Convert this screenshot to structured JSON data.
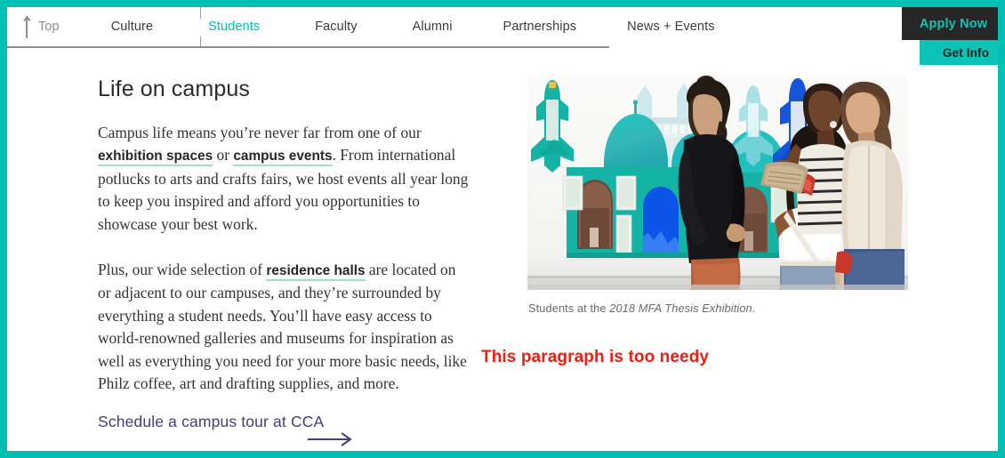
{
  "theme": {
    "teal": "#00bfb3",
    "teal_button": "#0cc3b6",
    "dark": "#262626",
    "link_purple": "#463b7b",
    "link_underline": "#9fd9d2",
    "annotation_red": "#ee1d11",
    "body_text": "#333333"
  },
  "nav": {
    "top": {
      "label": "Top",
      "icon": "arrow-up-icon"
    },
    "items": [
      {
        "label": "Culture",
        "active": false
      },
      {
        "label": "Students",
        "active": true
      },
      {
        "label": "Faculty",
        "active": false
      },
      {
        "label": "Alumni",
        "active": false
      },
      {
        "label": "Partnerships",
        "active": false
      },
      {
        "label": "News + Events",
        "active": false
      }
    ]
  },
  "cta": {
    "apply_label": "Apply Now",
    "info_label": "Get Info"
  },
  "main": {
    "heading": "Life on campus",
    "paragraph1": {
      "part1": "Campus life means you’re never far from one of our ",
      "link1": "exhibition spaces",
      "part2": " or ",
      "link2": "campus events",
      "part3": ". From international potlucks to arts and crafts fairs, we host events all year long to keep you inspired and afford you opportunities to showcase your best work."
    },
    "paragraph2": {
      "part1": "Plus, our wide selection of ",
      "link1": "residence halls",
      "part2": " are located on or adjacent to our campuses, and they’re surrounded by everything a student needs. You’ll have easy access to world-renowned galleries and museums for inspiration as well as everything you need for your more basic needs, like Philz coffee, art and drafting supplies, and more."
    },
    "tour_link": {
      "label": "Schedule a campus tour at CCA",
      "icon": "arrow-right-icon"
    }
  },
  "media": {
    "photo_alt": "Students viewing teal and blue mosque-shaped artworks in a white gallery",
    "caption_prefix": "Students at the ",
    "caption_italic": "2018 MFA Thesis Exhibition",
    "caption_suffix": "."
  },
  "annotation": {
    "text": "This paragraph is too needy"
  }
}
